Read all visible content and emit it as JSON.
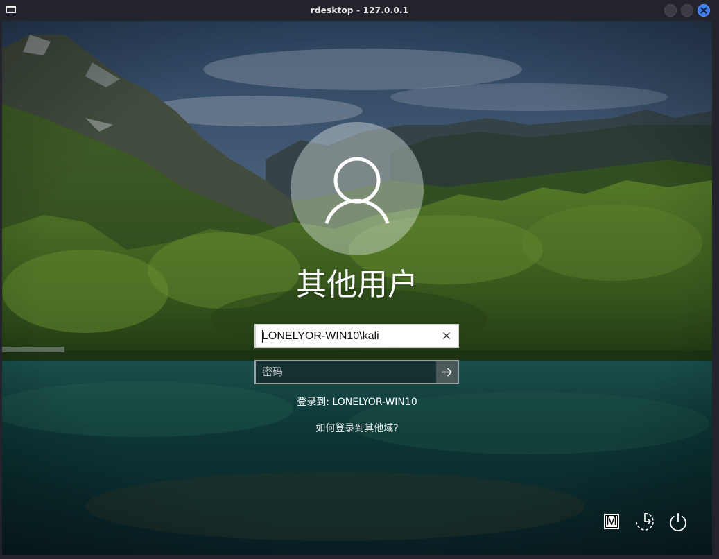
{
  "window": {
    "title": "rdesktop - 127.0.0.1",
    "close_color": "#3b7cf0"
  },
  "login": {
    "user_display_name": "其他用户",
    "username_value": "LONELYOR-WIN10\\kali",
    "password_placeholder": "密码",
    "signin_to": "登录到: LONELYOR-WIN10",
    "other_domain_link": "如何登录到其他域?"
  },
  "bottom_bar": {
    "input_method_label": "M",
    "icons": [
      "input-method-icon",
      "ease-of-access-icon",
      "power-icon"
    ]
  }
}
